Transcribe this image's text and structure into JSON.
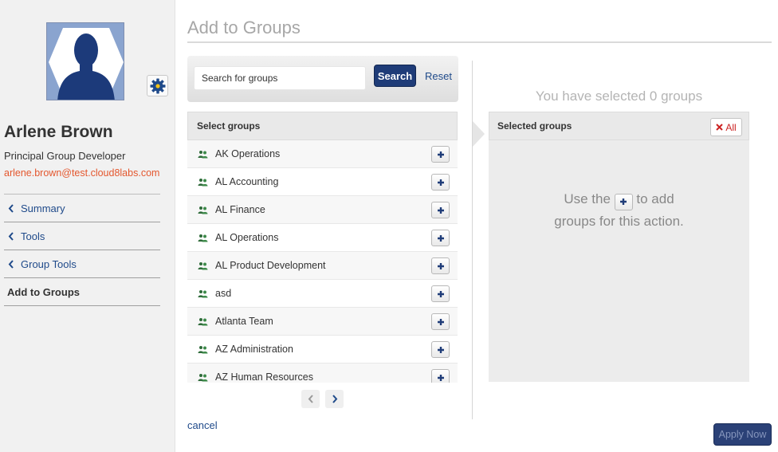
{
  "profile": {
    "name": "Arlene Brown",
    "title": "Principal Group Developer",
    "email": "arlene.brown@test.cloud8labs.com",
    "avatar_icon": "person-silhouette-icon",
    "settings_icon": "gear-icon"
  },
  "nav": {
    "items": [
      {
        "label": "Summary"
      },
      {
        "label": "Tools"
      },
      {
        "label": "Group Tools"
      }
    ],
    "active_label": "Add to Groups"
  },
  "page": {
    "title": "Add to Groups"
  },
  "search": {
    "placeholder": "Search for groups",
    "button_label": "Search",
    "reset_label": "Reset"
  },
  "groups": {
    "header": "Select groups",
    "items": [
      {
        "name": "AK Operations"
      },
      {
        "name": "AL Accounting"
      },
      {
        "name": "AL Finance"
      },
      {
        "name": "AL Operations"
      },
      {
        "name": "AL Product Development"
      },
      {
        "name": "asd"
      },
      {
        "name": "Atlanta Team"
      },
      {
        "name": "AZ Administration"
      },
      {
        "name": "AZ Human Resources"
      }
    ]
  },
  "selected": {
    "count_text": "You have selected 0 groups",
    "header": "Selected groups",
    "clear_label": "All",
    "hint_before": "Use the",
    "hint_after_line1": "to add",
    "hint_line2": "groups for this action."
  },
  "footer": {
    "cancel_label": "cancel",
    "apply_label": "Apply Now"
  },
  "colors": {
    "accent": "#1f3c78",
    "link": "#1f4a8a",
    "email": "#e4572e",
    "danger": "#cc2222"
  }
}
